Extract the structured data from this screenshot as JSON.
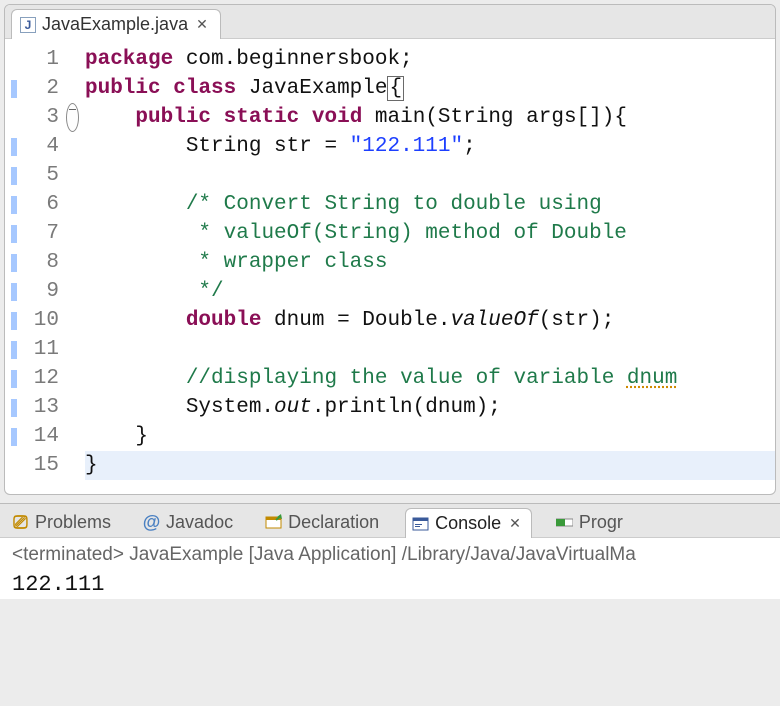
{
  "editor": {
    "tab": {
      "filename": "JavaExample.java"
    },
    "lines": [
      {
        "n": 1,
        "marker": false,
        "fold": false,
        "hl": false,
        "segs": [
          {
            "t": "package",
            "c": "kw"
          },
          {
            "t": " com.beginnersbook;",
            "c": ""
          }
        ]
      },
      {
        "n": 2,
        "marker": true,
        "fold": false,
        "hl": false,
        "segs": [
          {
            "t": "public",
            "c": "kw"
          },
          {
            "t": " ",
            "c": ""
          },
          {
            "t": "class",
            "c": "kw"
          },
          {
            "t": " JavaExample",
            "c": ""
          },
          {
            "t": "{",
            "c": "box-brace"
          }
        ]
      },
      {
        "n": 3,
        "marker": false,
        "fold": true,
        "hl": false,
        "segs": [
          {
            "t": "    ",
            "c": ""
          },
          {
            "t": "public",
            "c": "kw"
          },
          {
            "t": " ",
            "c": ""
          },
          {
            "t": "static",
            "c": "kw"
          },
          {
            "t": " ",
            "c": ""
          },
          {
            "t": "void",
            "c": "kw"
          },
          {
            "t": " main(String args[]){",
            "c": ""
          }
        ]
      },
      {
        "n": 4,
        "marker": true,
        "fold": false,
        "hl": false,
        "segs": [
          {
            "t": "        String str = ",
            "c": ""
          },
          {
            "t": "\"122.111\"",
            "c": "str"
          },
          {
            "t": ";",
            "c": ""
          }
        ]
      },
      {
        "n": 5,
        "marker": true,
        "fold": false,
        "hl": false,
        "segs": [
          {
            "t": "",
            "c": ""
          }
        ]
      },
      {
        "n": 6,
        "marker": true,
        "fold": false,
        "hl": false,
        "segs": [
          {
            "t": "        ",
            "c": ""
          },
          {
            "t": "/* Convert String to double using",
            "c": "cmt"
          }
        ]
      },
      {
        "n": 7,
        "marker": true,
        "fold": false,
        "hl": false,
        "segs": [
          {
            "t": "         ",
            "c": ""
          },
          {
            "t": "* ",
            "c": "cmt"
          },
          {
            "t": "valueOf",
            "c": "cmt"
          },
          {
            "t": "(String) method of Double",
            "c": "cmt"
          }
        ]
      },
      {
        "n": 8,
        "marker": true,
        "fold": false,
        "hl": false,
        "segs": [
          {
            "t": "         ",
            "c": ""
          },
          {
            "t": "* wrapper class",
            "c": "cmt"
          }
        ]
      },
      {
        "n": 9,
        "marker": true,
        "fold": false,
        "hl": false,
        "segs": [
          {
            "t": "         ",
            "c": ""
          },
          {
            "t": "*/",
            "c": "cmt"
          }
        ]
      },
      {
        "n": 10,
        "marker": true,
        "fold": false,
        "hl": false,
        "segs": [
          {
            "t": "        ",
            "c": ""
          },
          {
            "t": "double",
            "c": "kw"
          },
          {
            "t": " dnum = Double.",
            "c": ""
          },
          {
            "t": "valueOf",
            "c": "ital"
          },
          {
            "t": "(str);",
            "c": ""
          }
        ]
      },
      {
        "n": 11,
        "marker": true,
        "fold": false,
        "hl": false,
        "segs": [
          {
            "t": "",
            "c": ""
          }
        ]
      },
      {
        "n": 12,
        "marker": true,
        "fold": false,
        "hl": false,
        "segs": [
          {
            "t": "        ",
            "c": ""
          },
          {
            "t": "//displaying the value of variable ",
            "c": "cmt"
          },
          {
            "t": "dnum",
            "c": "cmt warn"
          }
        ]
      },
      {
        "n": 13,
        "marker": true,
        "fold": false,
        "hl": false,
        "segs": [
          {
            "t": "        System.",
            "c": ""
          },
          {
            "t": "out",
            "c": "ital"
          },
          {
            "t": ".println(dnum);",
            "c": ""
          }
        ]
      },
      {
        "n": 14,
        "marker": true,
        "fold": false,
        "hl": false,
        "segs": [
          {
            "t": "    }",
            "c": ""
          }
        ]
      },
      {
        "n": 15,
        "marker": false,
        "fold": false,
        "hl": true,
        "segs": [
          {
            "t": "}",
            "c": ""
          }
        ]
      }
    ]
  },
  "console": {
    "tabs": {
      "problems": "Problems",
      "javadoc": "Javadoc",
      "declaration": "Declaration",
      "console": "Console",
      "progress": "Progr"
    },
    "status": "<terminated> JavaExample [Java Application] /Library/Java/JavaVirtualMa",
    "output": "122.111"
  }
}
